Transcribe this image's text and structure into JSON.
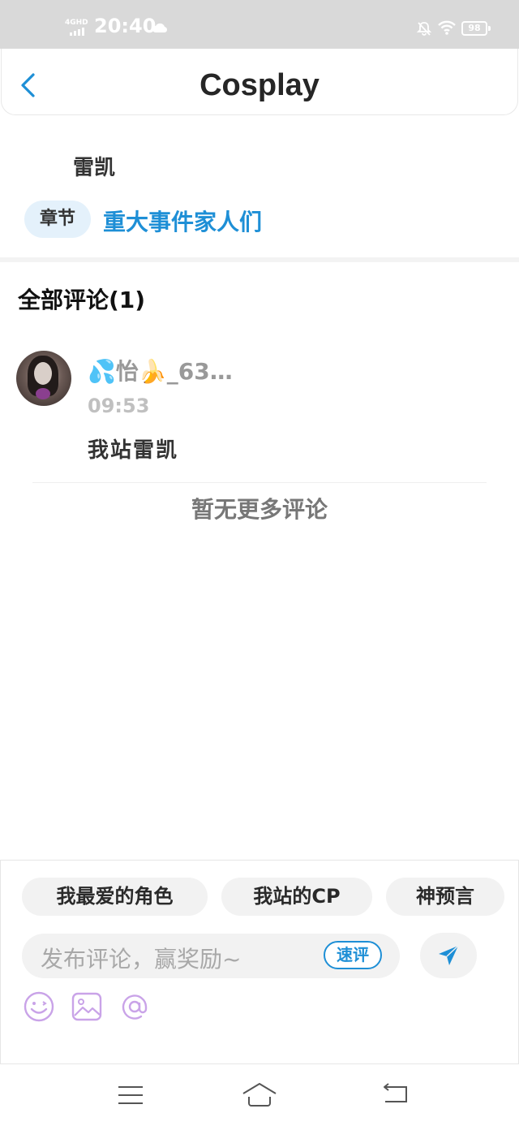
{
  "status_bar": {
    "network": "4GHD",
    "time": "20:40",
    "battery": "98"
  },
  "header": {
    "title": "Cosplay"
  },
  "post": {
    "author": "雷凯",
    "chapter_tag": "章节",
    "chapter_title": "重大事件家人们"
  },
  "comments": {
    "title": "全部评论(1)",
    "items": [
      {
        "user": "💦怡🍌_63…",
        "time": "09:53",
        "text": "我站雷凯"
      }
    ],
    "no_more": "暂无更多评论"
  },
  "composer": {
    "chips": [
      "我最爱的角色",
      "我站的CP",
      "神预言"
    ],
    "placeholder": "发布评论，赢奖励~",
    "quick_review": "速评"
  },
  "colors": {
    "accent": "#1e8fd6",
    "status_bar_bg": "#d9d9d9",
    "tool_icon": "#c9a3e8"
  },
  "icons": {
    "back": "chevron-left-icon",
    "send": "send-plane-icon",
    "emoji": "smiley-icon",
    "image": "image-icon",
    "mention": "at-icon"
  }
}
